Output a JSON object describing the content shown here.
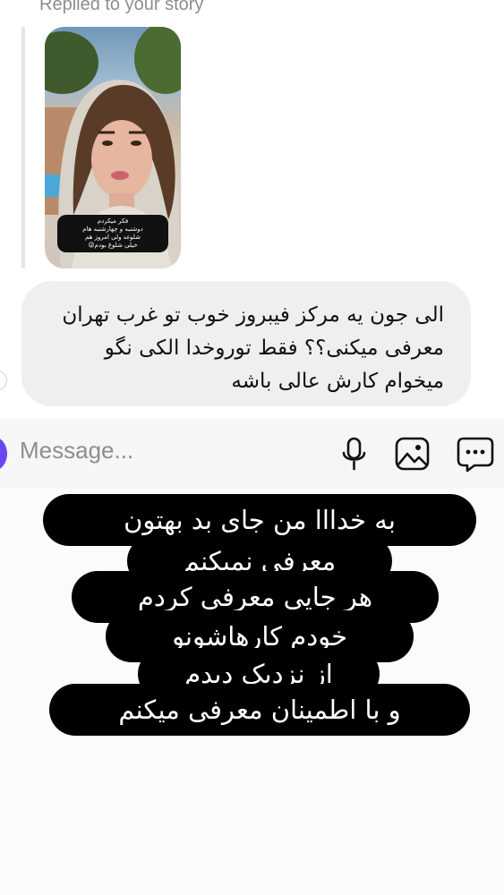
{
  "reply_header": {
    "text": "Replied to your story"
  },
  "story": {
    "caption": "فکر میکردم\nدوشنبه و چهارشنبه هام\nشلوغه ولی امروز هم\nخیلی شلوغ بودم😜"
  },
  "message": {
    "text": "الی جون یه مرکز فیبروز خوب تو غرب تهران\nمعرفی میکنی؟؟ فقط توروخدا الکی نگو\nمیخوام کارش عالی باشه"
  },
  "composer": {
    "placeholder": "Message...",
    "icons": [
      "microphone-icon",
      "gallery-icon",
      "chat-sticker-icon"
    ]
  },
  "overlay": {
    "lines": [
      "به خدااا من جای بد بهتون",
      "معرفی نمیکنم",
      "هر جایی معرفی کردم",
      "خودم کارهاشونو",
      "از نزدیک دیدم",
      "و با اطمینان معرفی میکنم"
    ]
  },
  "colors": {
    "bubble_bg": "#efeff1",
    "composer_bg": "#f6f6f7",
    "avatar_accent": "#6d45f0",
    "overlay_bg": "#000000",
    "overlay_text": "#ffffff"
  }
}
